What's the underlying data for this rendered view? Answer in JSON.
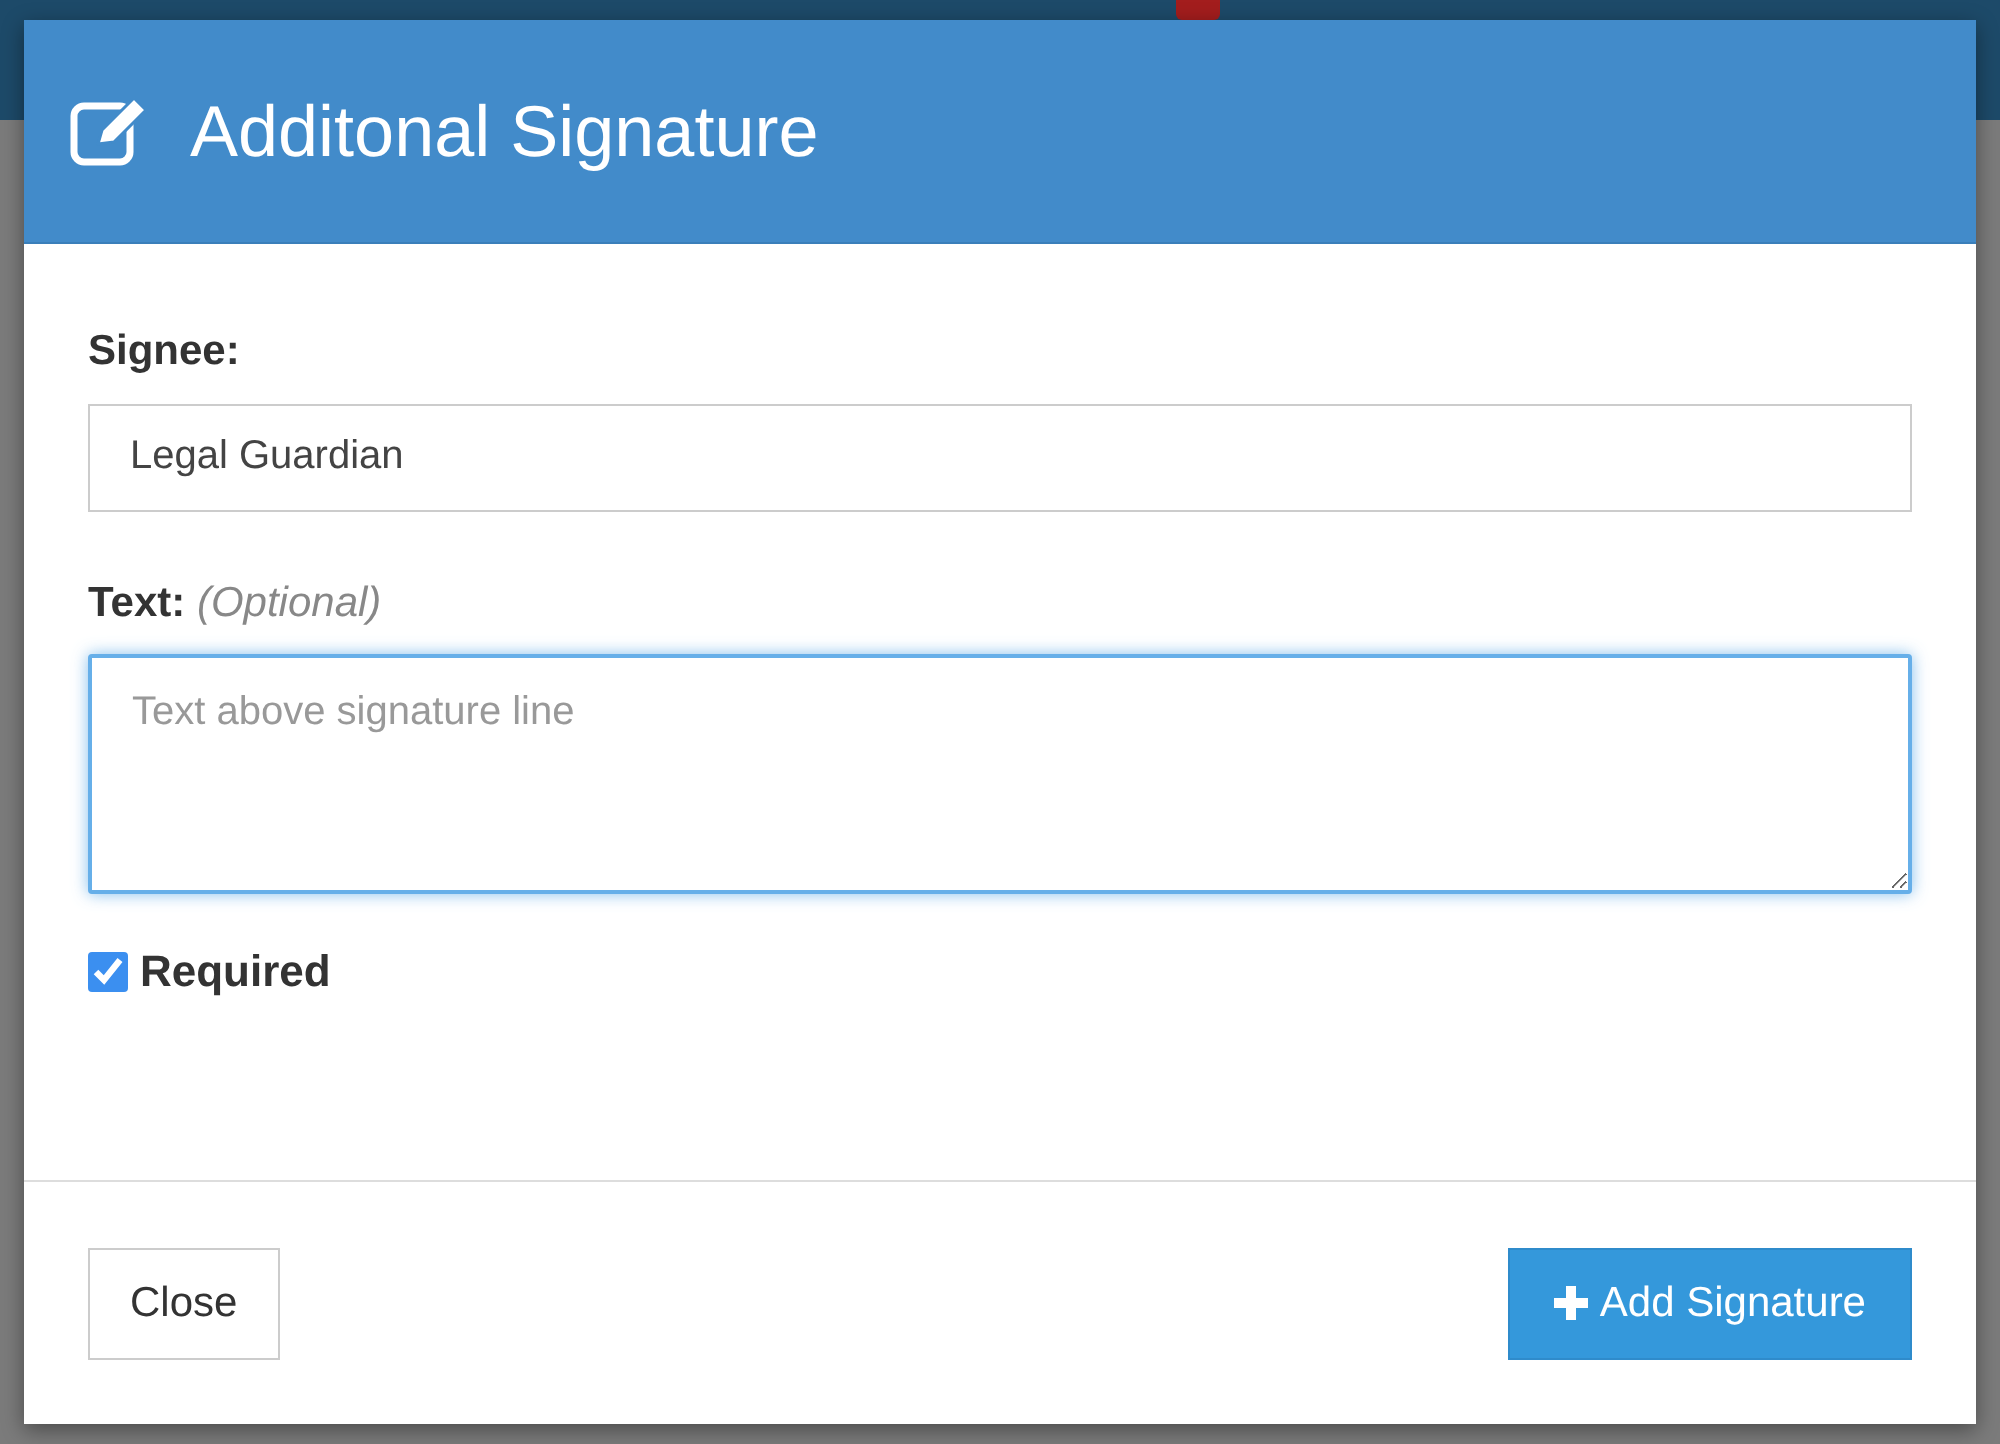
{
  "dialog": {
    "title": "Additonal Signature",
    "fields": [
      {
        "kind": "input",
        "label": "Signee:",
        "value": "Legal Guardian"
      },
      {
        "kind": "textarea",
        "label": "Text:",
        "hint": "(Optional)",
        "placeholder": "Text above signature line",
        "focused": true
      }
    ],
    "checkbox": {
      "label": "Required",
      "checked": true
    },
    "buttons": [
      {
        "kind": "secondary",
        "label": "Close"
      },
      {
        "kind": "primary",
        "label": "Add Signature"
      }
    ]
  }
}
